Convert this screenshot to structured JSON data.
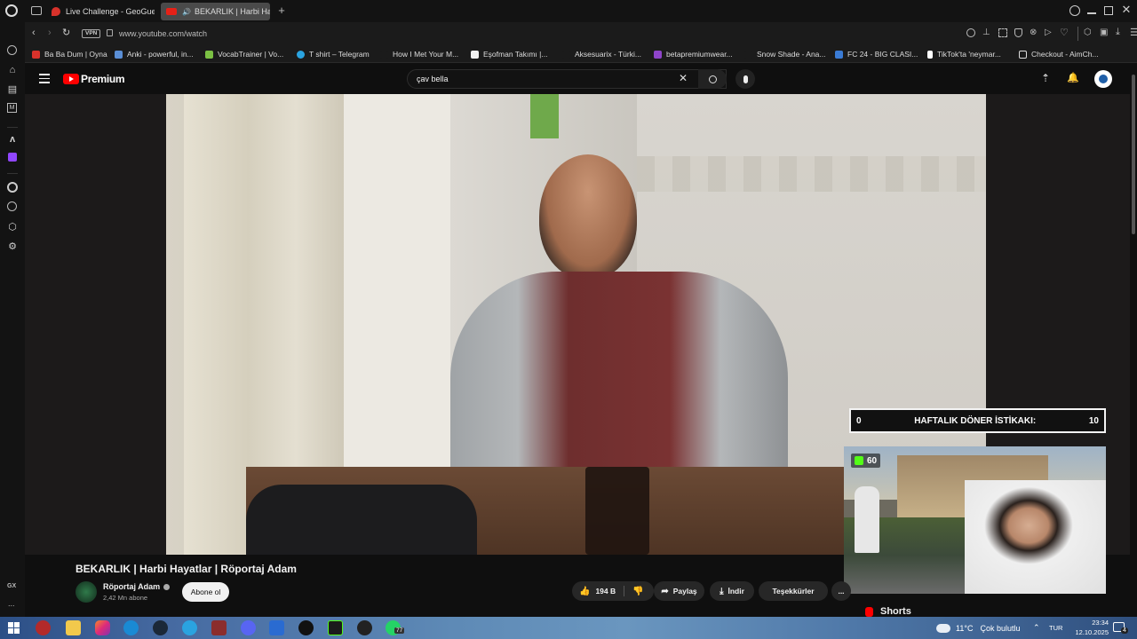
{
  "browser": {
    "tabs": [
      {
        "label": "Live Challenge - GeoGuessr",
        "favicon_color": "#d8322b",
        "active": false
      },
      {
        "label": "BEKARLIK | Harbi Hayatlar | Röportaj Adam",
        "favicon_color": "#e62117",
        "active": true
      }
    ],
    "new_tab_icon": "plus-icon",
    "vpn_label": "VPN",
    "url": "www.youtube.com/watch",
    "bookmarks": [
      {
        "label": "Ba Ba Dum | Oyna",
        "color": "#d9322b"
      },
      {
        "label": "Anki - powerful, in...",
        "color": "#5b8fd6"
      },
      {
        "label": "VocabTrainer | Vo...",
        "color": "#7bc043"
      },
      {
        "label": "T shirt – Telegram",
        "color": "#2aa3e0"
      },
      {
        "label": "How I Met Your M...",
        "color": "#1b1b1b"
      },
      {
        "label": "Eşofman Takımı |...",
        "color": "#f0f0f0"
      },
      {
        "label": "Aksesuarix - Türki...",
        "color": "#1b1b1b"
      },
      {
        "label": "betapremiumwear...",
        "color": "#8e44c9"
      },
      {
        "label": "Snow Shade - Ana...",
        "color": "#1b1b1b"
      },
      {
        "label": "FC 24 - BIG CLASI...",
        "color": "#3a7bd5"
      },
      {
        "label": "TikTok'ta 'neymar...",
        "color": "#ffffff"
      },
      {
        "label": "Checkout - AimCh...",
        "color": "#dddddd"
      }
    ]
  },
  "youtube": {
    "logo_text": "Premium",
    "search_value": "çav bella",
    "video_title": "BEKARLIK | Harbi Hayatlar | Röportaj Adam",
    "channel_name": "Röportaj Adam",
    "subscribers": "2,42 Mn abone",
    "subscribe_label": "Abone ol",
    "likes": "194 B",
    "share_label": "Paylaş",
    "download_label": "İndir",
    "thanks_label": "Teşekkürler",
    "more_label": "...",
    "shorts_label": "Shorts"
  },
  "stream_overlay": {
    "left_value": "0",
    "banner_text": "HAFTALIK DÖNER İSTİKAKI:",
    "right_value": "10",
    "kick_count": "60"
  },
  "sidebar": {
    "gx_label": "GX",
    "more_label": "..."
  },
  "taskbar": {
    "weather_temp": "11°C",
    "weather_desc": "Çok bulutlu",
    "language": "TUR",
    "time": "23:34",
    "date": "12.10.2025",
    "notif_count": "4",
    "badge_77": "77"
  },
  "colors": {
    "youtube_red": "#ff0000",
    "kick_green": "#53fc18",
    "dark_bg": "#0f0f0f"
  }
}
